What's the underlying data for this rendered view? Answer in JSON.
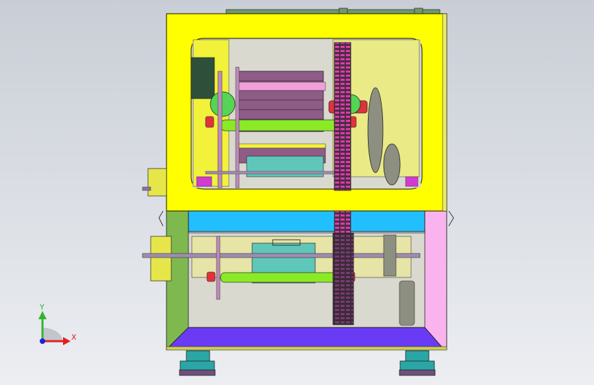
{
  "viewport": {
    "background_top": "#c9ced6",
    "background_bottom": "#eceef2"
  },
  "colors": {
    "frame_yellow": "#ffff00",
    "frame_outline": "#3a3a00",
    "blue_band": "#22bfff",
    "left_panel": "#7fb84f",
    "right_panel": "#f9b3ee",
    "base_plate": "#6a3bf5",
    "gear_dark": "#4a2d48",
    "gear_pink": "#e23aa8",
    "shaft_green": "#8bea26",
    "roller_purple": "#8e5c86",
    "teal": "#5fc7b9",
    "motor_dark": "#2e4f3a",
    "pulley_gray": "#8d8f80",
    "red_part": "#e0323a",
    "foot_teal": "#2aa6a6",
    "foot_base": "#6f4f7b"
  },
  "triad": {
    "y_label": "Y",
    "x_label": "X",
    "y_color": "#2fb52f",
    "x_color": "#e02020",
    "z_color": "#2020e0"
  }
}
